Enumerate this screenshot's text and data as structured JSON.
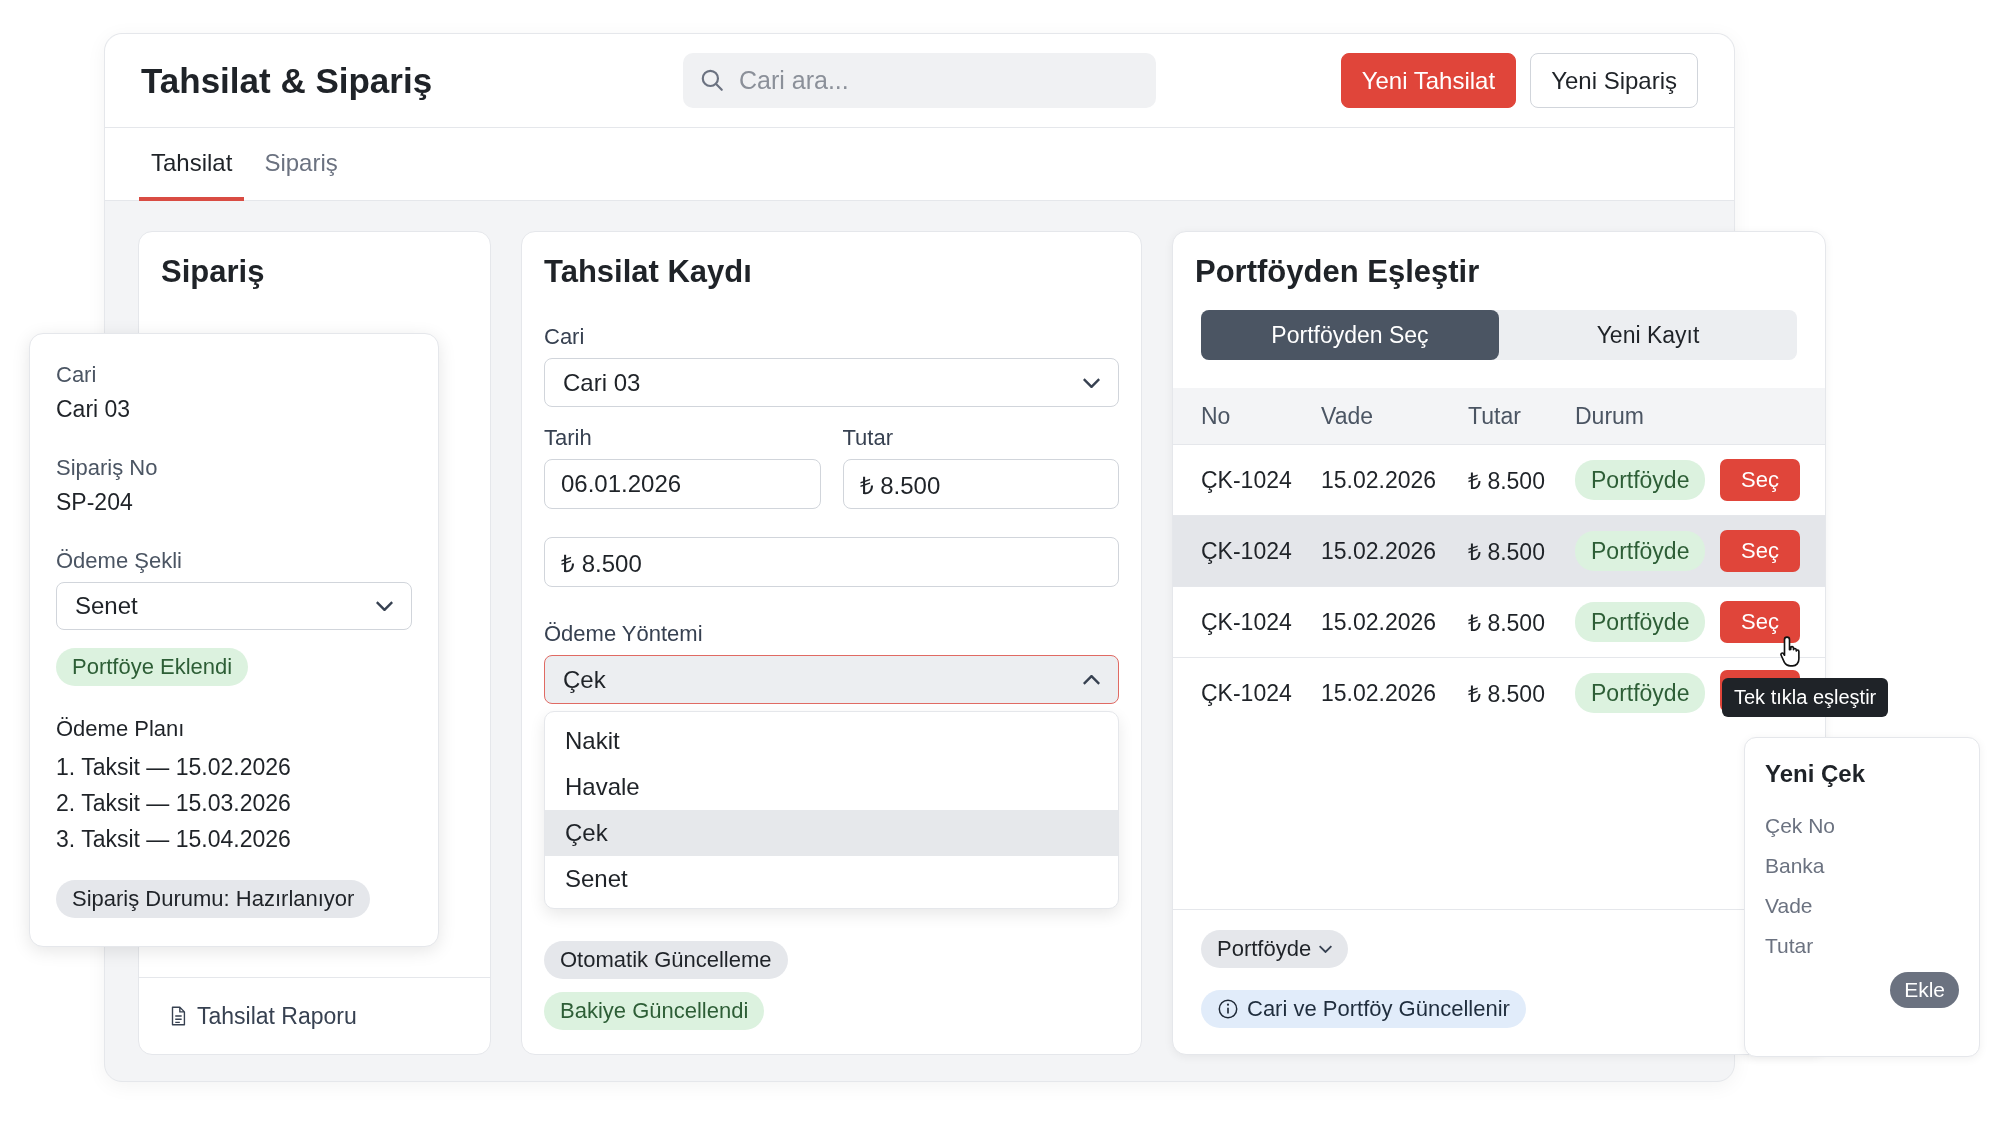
{
  "header": {
    "title": "Tahsilat & Sipariş",
    "search": {
      "placeholder": "Cari ara..."
    },
    "buttons": [
      {
        "label": "Yeni Tahsilat",
        "kind": "primary"
      },
      {
        "label": "Yeni Sipariş",
        "kind": "secondary"
      }
    ]
  },
  "tabs": [
    {
      "label": "Tahsilat",
      "selected": true
    },
    {
      "label": "Sipariş",
      "selected": false
    }
  ],
  "order_card": {
    "title": "Sipariş",
    "footer_link": "Tahsilat Raporu"
  },
  "order_popover": {
    "fields": [
      {
        "label": "Cari",
        "value": "Cari 03"
      },
      {
        "label": "Sipariş No",
        "value": "SP-204"
      }
    ],
    "payment_label": "Ödeme Şekli",
    "payment_value": "Senet",
    "badge": "Portföye Eklendi",
    "plan_label": "Ödeme Planı",
    "plan": [
      "1. Taksit — 15.02.2026",
      "2. Taksit — 15.03.2026",
      "3. Taksit — 15.04.2026"
    ],
    "status": "Sipariş Durumu: Hazırlanıyor"
  },
  "collection_card": {
    "title": "Tahsilat Kaydı",
    "cari_label": "Cari",
    "cari_value": "Cari 03",
    "date_label": "Tarih",
    "date_value": "06.01.2026",
    "amount_label": "Tutar",
    "amount_value": "₺ 8.500",
    "total_value": "₺ 8.500",
    "method_label": "Ödeme Yöntemi",
    "method_value": "Çek",
    "method_expanded": true,
    "options": [
      {
        "label": "Nakit",
        "selected": false
      },
      {
        "label": "Havale",
        "selected": false
      },
      {
        "label": "Çek",
        "selected": true
      },
      {
        "label": "Senet",
        "selected": false
      }
    ],
    "chips": [
      {
        "label": "Otomatik Güncelleme",
        "kind": "neutral"
      },
      {
        "label": "Bakiye Güncellendi",
        "kind": "success"
      }
    ]
  },
  "portfolio_card": {
    "title": "Portföyden Eşleştir",
    "segments": [
      {
        "label": "Portföyden Seç",
        "selected": true
      },
      {
        "label": "Yeni Kayıt",
        "selected": false
      }
    ],
    "table": {
      "columns": [
        "No",
        "Vade",
        "Tutar",
        "Durum"
      ],
      "rows": [
        {
          "no": "ÇK-1024",
          "due": "15.02.2026",
          "amount": "₺ 8.500",
          "status": "Portföyde",
          "action": "Seç",
          "highlighted": false
        },
        {
          "no": "ÇK-1024",
          "due": "15.02.2026",
          "amount": "₺ 8.500",
          "status": "Portföyde",
          "action": "Seç",
          "highlighted": true
        },
        {
          "no": "ÇK-1024",
          "due": "15.02.2026",
          "amount": "₺ 8.500",
          "status": "Portföyde",
          "action": "Seç",
          "highlighted": false
        },
        {
          "no": "ÇK-1024",
          "due": "15.02.2026",
          "amount": "₺ 8.500",
          "status": "Portföyde",
          "highlighted": false
        }
      ]
    },
    "filter": "Portföyde",
    "info": "Cari ve Portföy Güncellenir"
  },
  "tooltip": "Tek tıkla eşleştir",
  "new_check": {
    "title": "Yeni Çek",
    "fields": [
      "Çek No",
      "Banka",
      "Vade",
      "Tutar"
    ],
    "button": "Ekle"
  }
}
